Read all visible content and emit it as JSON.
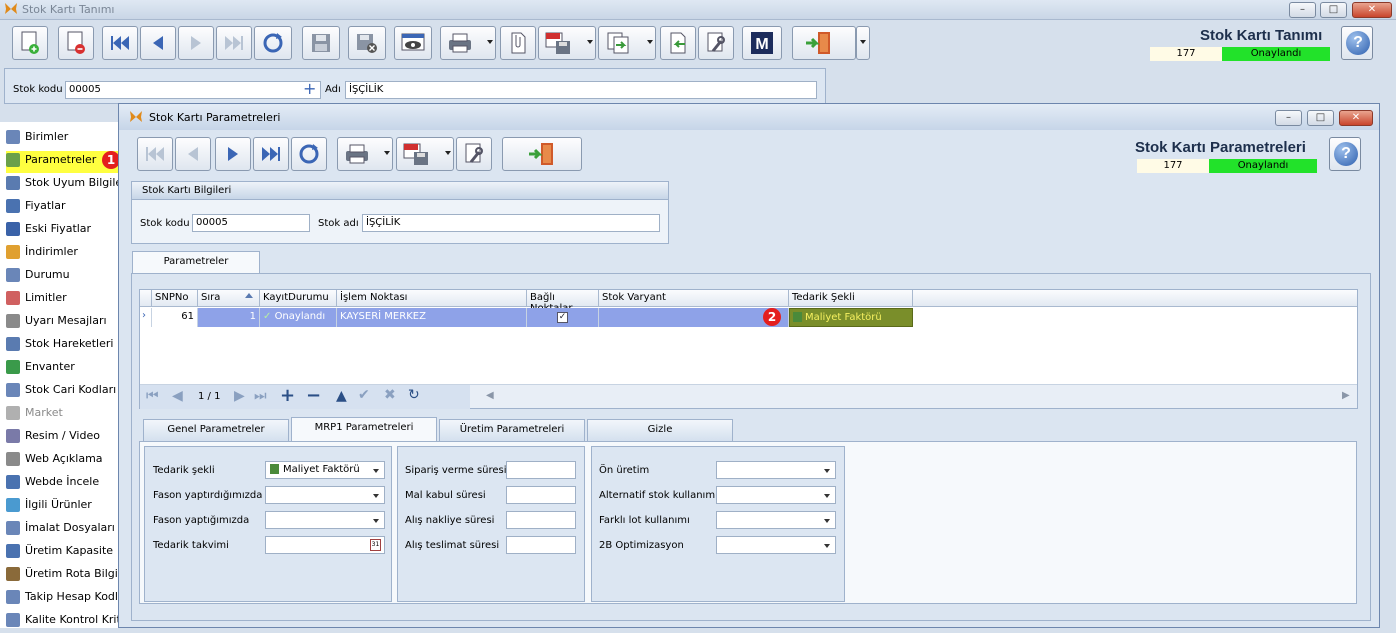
{
  "window": {
    "title": "Stok Kartı Tanımı"
  },
  "main_header": {
    "title": "Stok Kartı Tanımı",
    "count": "177",
    "status": "Onaylandı"
  },
  "main_fields": {
    "stok_kodu_label": "Stok kodu",
    "stok_kodu_value": "00005",
    "adi_label": "Adı",
    "adi_value": "İŞÇİLİK"
  },
  "sidebar": {
    "items": [
      {
        "label": "Birimler",
        "color": "#6a86b8"
      },
      {
        "label": "Parametreler",
        "color": "#6aa04a"
      },
      {
        "label": "Stok Uyum Bilgileri",
        "color": "#5a7bb0"
      },
      {
        "label": "Fiyatlar",
        "color": "#4a72b0"
      },
      {
        "label": "Eski Fiyatlar",
        "color": "#3a62a8"
      },
      {
        "label": "İndirimler",
        "color": "#e0a030"
      },
      {
        "label": "Durumu",
        "color": "#6a86b8"
      },
      {
        "label": "Limitler",
        "color": "#d06060"
      },
      {
        "label": "Uyarı Mesajları",
        "color": "#8a8a8a"
      },
      {
        "label": "Stok Hareketleri",
        "color": "#5a7bb0"
      },
      {
        "label": "Envanter",
        "color": "#3a9a4a"
      },
      {
        "label": "Stok Cari Kodları",
        "color": "#6a86b8"
      },
      {
        "label": "Market",
        "color": "#b0b0b0"
      },
      {
        "label": "Resim / Video",
        "color": "#7a7aa8"
      },
      {
        "label": "Web Açıklama",
        "color": "#8a8a8a"
      },
      {
        "label": "Webde İncele",
        "color": "#4a72b0"
      },
      {
        "label": "İlgili Ürünler",
        "color": "#4a9ad0"
      },
      {
        "label": "İmalat Dosyaları",
        "color": "#6a86b8"
      },
      {
        "label": "Üretim Kapasite",
        "color": "#4a72b0"
      },
      {
        "label": "Üretim Rota Bilgileri",
        "color": "#8a6a3a"
      },
      {
        "label": "Takip Hesap Kodları",
        "color": "#6a86b8"
      },
      {
        "label": "Kalite Kontrol Kriterleri",
        "color": "#6a86b8"
      }
    ]
  },
  "badges": {
    "b1": "1",
    "b2": "2"
  },
  "dialog": {
    "title": "Stok Kartı Parametreleri",
    "header_title": "Stok Kartı Parametreleri",
    "count": "177",
    "status": "Onaylandı",
    "info_group": {
      "title": "Stok Kartı Bilgileri",
      "kod_label": "Stok kodu",
      "kod_value": "00005",
      "adi_label": "Stok adı",
      "adi_value": "İŞÇİLİK"
    },
    "main_tab": "Parametreler",
    "grid": {
      "columns": [
        "SNPNo",
        "Sıra",
        "KayıtDurumu",
        "İşlem Noktası",
        "Bağlı Noktalar",
        "Stok Varyant",
        "Tedarik Şekli"
      ],
      "row": {
        "snpno": "61",
        "sira": "1",
        "durum": "Onaylandı",
        "islem": "KAYSERİ MERKEZ",
        "varyant": "",
        "tedarik": "Maliyet Faktörü"
      },
      "pager": "1 / 1"
    },
    "subtabs": [
      "Genel Parametreler",
      "MRP1 Parametreleri",
      "Üretim Parametreleri",
      "Gizle"
    ],
    "mrp": {
      "col1": [
        {
          "label": "Tedarik şekli",
          "value": "Maliyet Faktörü"
        },
        {
          "label": "Fason yaptırdığımızda",
          "value": ""
        },
        {
          "label": "Fason yaptığımızda",
          "value": ""
        },
        {
          "label": "Tedarik takvimi",
          "value": ""
        }
      ],
      "col2": [
        {
          "label": "Sipariş verme süresi",
          "value": ""
        },
        {
          "label": "Mal kabul süresi",
          "value": ""
        },
        {
          "label": "Alış nakliye süresi",
          "value": ""
        },
        {
          "label": "Alış teslimat süresi",
          "value": ""
        }
      ],
      "col3": [
        {
          "label": "Ön üretim",
          "value": ""
        },
        {
          "label": "Alternatif stok kullanımı",
          "value": ""
        },
        {
          "label": "Farklı lot kullanımı",
          "value": ""
        },
        {
          "label": "2B Optimizasyon",
          "value": ""
        }
      ]
    }
  }
}
